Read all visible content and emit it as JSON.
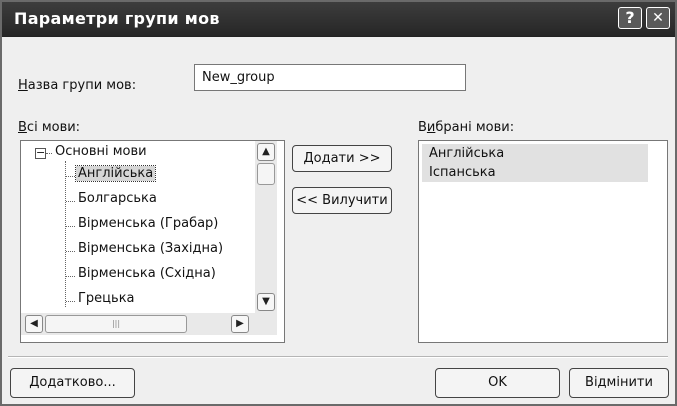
{
  "window": {
    "title": "Параметри групи мов",
    "help_glyph": "?",
    "close_glyph": "✕"
  },
  "group_name": {
    "label": "Назва групи мов:",
    "value": "New_group"
  },
  "all_languages": {
    "label": "Всі мови:",
    "root": "Основні мови",
    "expander": "−",
    "items": [
      "Англійська",
      "Болгарська",
      "Вірменська (Грабар)",
      "Вірменська (Західна)",
      "Вірменська (Східна)",
      "Грецька"
    ],
    "selected": "Англійська"
  },
  "buttons": {
    "add": "Додати >>",
    "remove": "<< Вилучити",
    "advanced": "Додатково...",
    "ok": "OK",
    "cancel": "Відмінити"
  },
  "chosen_languages": {
    "label": "Вибрані мови:",
    "items": [
      "Англійська",
      "Іспанська"
    ]
  },
  "scroll_glyphs": {
    "up": "▲",
    "down": "▼",
    "left": "◀",
    "right": "▶",
    "grip": "|||"
  }
}
